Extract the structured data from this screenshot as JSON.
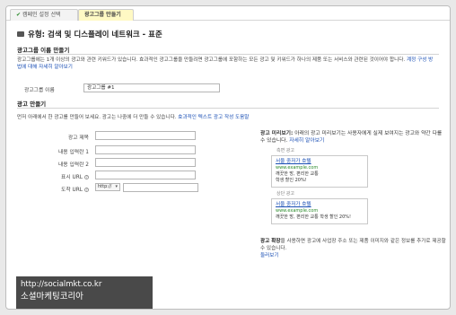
{
  "tabs": {
    "done_label": "캠페인 설정 선택",
    "active_label": "광고그룹 만들기"
  },
  "page_title": "유형: 검색 및 디스플레이 네트워크 - 표준",
  "adgroup_section": {
    "heading": "광고그룹 이름 만들기",
    "description": "광고그룹에는 1개 이상의 광고와 관련 키워드가 있습니다. 효과적인 광고그룹을 만들려면 광고그룹에 포함하는 모든 광고 및 키워드가 하나의 제품 또는 서비스와 관련된 것이어야 합니다.",
    "description_link": "계정 구성 방법에 대해 자세히 알아보기",
    "name_label": "광고그룹 이름",
    "name_value": "광고그룹 #1"
  },
  "ad_section": {
    "heading": "광고 만들기",
    "description": "먼저 아래에서 한 광고를 만들어 보세요. 광고는 나중에 더 만들 수 있습니다.",
    "description_link": "효과적인 텍스트 광고 작성 도움말",
    "fields": {
      "headline_label": "광고 제목",
      "desc1_label": "내용 입력란 1",
      "desc2_label": "내용 입력란 2",
      "display_url_label": "표시 URL",
      "dest_url_label": "도착 URL",
      "protocol_value": "http://"
    }
  },
  "preview": {
    "heading": "광고 미리보기:",
    "heading_text": "아래의 광고 미리보기는 사용자에게 실제 보여지는 광고와 약간 다를 수 있습니다.",
    "heading_link": "자세히 알아보기",
    "side_label": "측면 광고",
    "top_label": "상단 광고",
    "side_ad": {
      "title": "서울 중저가 호텔",
      "url": "www.example.com",
      "line1": "깨끗한 방, 편리한 교통",
      "line2": "학생 할인 20%!"
    },
    "top_ad": {
      "title": "서울 중저가 호텔",
      "url": "www.example.com",
      "line1": "깨끗한 방, 편리한 교통 학생 할인 20%!"
    }
  },
  "extensions": {
    "heading": "광고 확장",
    "text": "을 사용하면 광고에 사업장 주소 또는 제품 이미지와 같은 정보를 추가로 제공할 수 있습니다.",
    "link": "둘러보기"
  },
  "watermark": {
    "url": "http://socialmkt.co.kr",
    "name": "소셜마케팅코리아"
  }
}
